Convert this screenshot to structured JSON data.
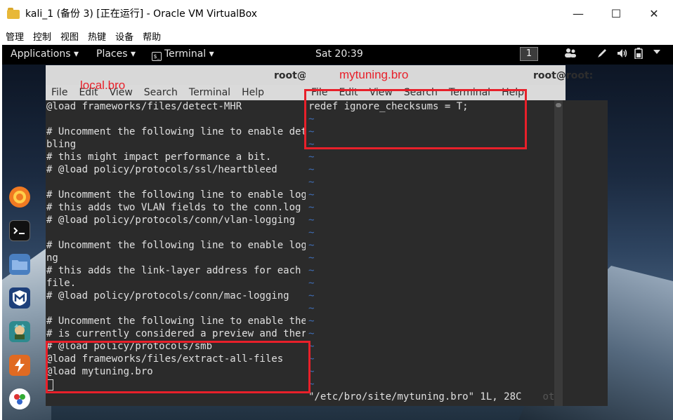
{
  "window": {
    "title": "kali_1 (备份 3) [正在运行] - Oracle VM VirtualBox",
    "minimize": "—",
    "maximize": "☐",
    "close": "✕",
    "menus": [
      "管理",
      "控制",
      "视图",
      "热键",
      "设备",
      "帮助"
    ]
  },
  "topbar": {
    "applications": "Applications ▾",
    "places": "Places ▾",
    "terminal": "Terminal ▾",
    "terminal_icon": "$_",
    "clock": "Sat 20:39",
    "workspace": "1"
  },
  "dock": {
    "items": [
      "firefox-icon",
      "terminal-icon",
      "files-icon",
      "metasploit-icon",
      "armitage-icon",
      "burpsuite-icon",
      "show-apps-icon"
    ]
  },
  "back_terminal": {
    "title": "root@",
    "menus": [
      "File",
      "Edit",
      "View",
      "Search",
      "Terminal",
      "Help"
    ],
    "lines": [
      "@load frameworks/files/detect-MHR",
      "",
      "# Uncomment the following line to enable detection of the heartbleed attack. Ena",
      "bling",
      "# this might impact performance a bit.",
      "# @load policy/protocols/ssl/heartbleed",
      "",
      "# Uncomment the following line to enable logging of connection VLANs. Enabling",
      "# this adds two VLAN fields to the conn.log file.",
      "# @load policy/protocols/conn/vlan-logging",
      "",
      "# Uncomment the following line to enable logging of link-layer addresses. Enabli",
      "ng",
      "# this adds the link-layer address for each connection endpoint to the conn.log",
      "file.",
      "# @load policy/protocols/conn/mac-logging",
      "",
      "# Uncomment the following line to enable the SMB analyzer.  The analyzer",
      "# is currently considered a preview and therefore not loaded by default.",
      "# @load policy/protocols/smb",
      "@load frameworks/files/extract-all-files",
      "@load mytuning.bro",
      ""
    ]
  },
  "front_terminal": {
    "title": "root@root: ~",
    "menus": [
      "File",
      "Edit",
      "View",
      "Search",
      "Terminal",
      "Help"
    ],
    "lines": [
      "redef ignore_checksums = T;"
    ],
    "tilde": "~",
    "tilde_count": 22,
    "status": "\"/etc/bro/site/mytuning.bro\" 1L, 28C",
    "status_ghost": "ot"
  },
  "annotations": {
    "local_label": "local.bro",
    "mytuning_label": "mytuning.bro"
  }
}
